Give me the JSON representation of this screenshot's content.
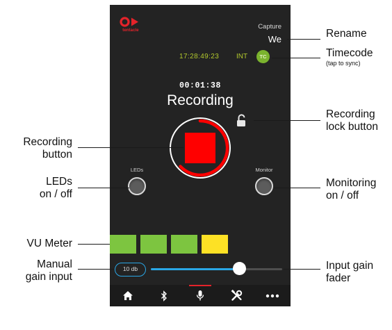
{
  "app": {
    "logo_text": "tentacle",
    "capture_label": "Capture",
    "rename_value": "We",
    "timecode": "17:28:49:23",
    "timecode_source": "INT",
    "tc_button_label": "TC",
    "elapsed_time": "00:01:38",
    "status_text": "Recording",
    "leds_label": "LEDs",
    "monitor_label": "Monitor",
    "gain_value": "10 db",
    "gain_fader_level_percent": 67,
    "vu_meter": {
      "levels": [
        "green",
        "green",
        "green",
        "yellow"
      ]
    },
    "tabs": [
      {
        "icon": "home-icon"
      },
      {
        "icon": "bluetooth-icon"
      },
      {
        "icon": "microphone-icon",
        "active": true
      },
      {
        "icon": "tools-icon"
      },
      {
        "icon": "more-icon"
      }
    ]
  },
  "colors": {
    "phone_bg": "#232323",
    "record_red": "#ff0000",
    "timecode_green": "#b3c92d",
    "tc_button_green": "#7bb32e",
    "fader_blue": "#2aa7e6",
    "vu_green": "#7dc540",
    "vu_yellow": "#fde125",
    "brand_red": "#e4232a"
  },
  "callouts": {
    "rename": "Rename",
    "timecode": "Timecode",
    "timecode_sub": "(tap to sync)",
    "recording_lock": "Recording\nlock button",
    "recording_button": "Recording\nbutton",
    "leds": "LEDs\non / off",
    "monitoring": "Monitoring\non / off",
    "vu_meter": "VU Meter",
    "manual_gain": "Manual\ngain input",
    "input_gain": "Input gain\nfader"
  }
}
